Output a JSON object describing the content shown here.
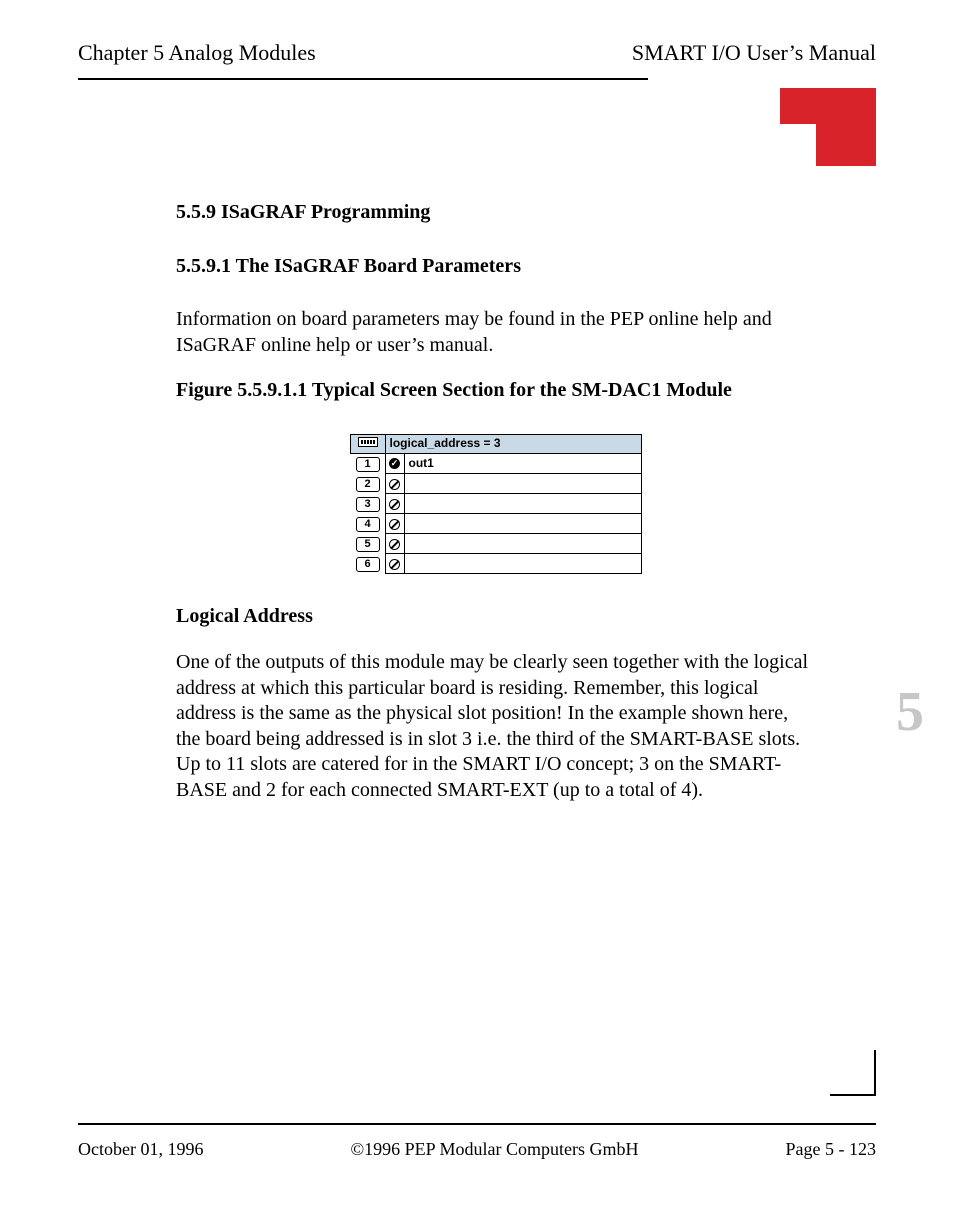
{
  "header": {
    "chapter": "Chapter 5  Analog Modules",
    "manual": "SMART I/O User’s Manual"
  },
  "section_heading": "5.5.9 ISaGRAF Programming",
  "subsection_heading": "5.5.9.1 The ISaGRAF Board Parameters",
  "intro_para": "Information on board parameters may be found in the PEP online help and ISaGRAF online help or user’s manual.",
  "figure_caption": "Figure 5.5.9.1.1 Typical Screen Section for the SM-DAC1 Module",
  "figure": {
    "header_label": "logical_address = 3",
    "rows": [
      {
        "n": "1",
        "filled": true,
        "val": "out1"
      },
      {
        "n": "2",
        "filled": false,
        "val": ""
      },
      {
        "n": "3",
        "filled": false,
        "val": ""
      },
      {
        "n": "4",
        "filled": false,
        "val": ""
      },
      {
        "n": "5",
        "filled": false,
        "val": ""
      },
      {
        "n": "6",
        "filled": false,
        "val": ""
      }
    ]
  },
  "logical_address_heading": "Logical Address",
  "logical_address_para": "One of the outputs of this module may be clearly seen together with the logical address at which this particular board is residing. Remember, this logical address is the same as the physical slot position! In the example shown here, the board being addressed is in slot 3 i.e. the third of the SMART-BASE slots. Up to 11 slots are catered for in the SMART I/O concept; 3 on the SMART-BASE and 2 for each connected SMART-EXT (up to a total of 4).",
  "side_chapter_num": "5",
  "footer": {
    "date": "October 01, 1996",
    "copyright": "©1996 PEP Modular Computers GmbH",
    "page": "Page 5 - 123"
  }
}
